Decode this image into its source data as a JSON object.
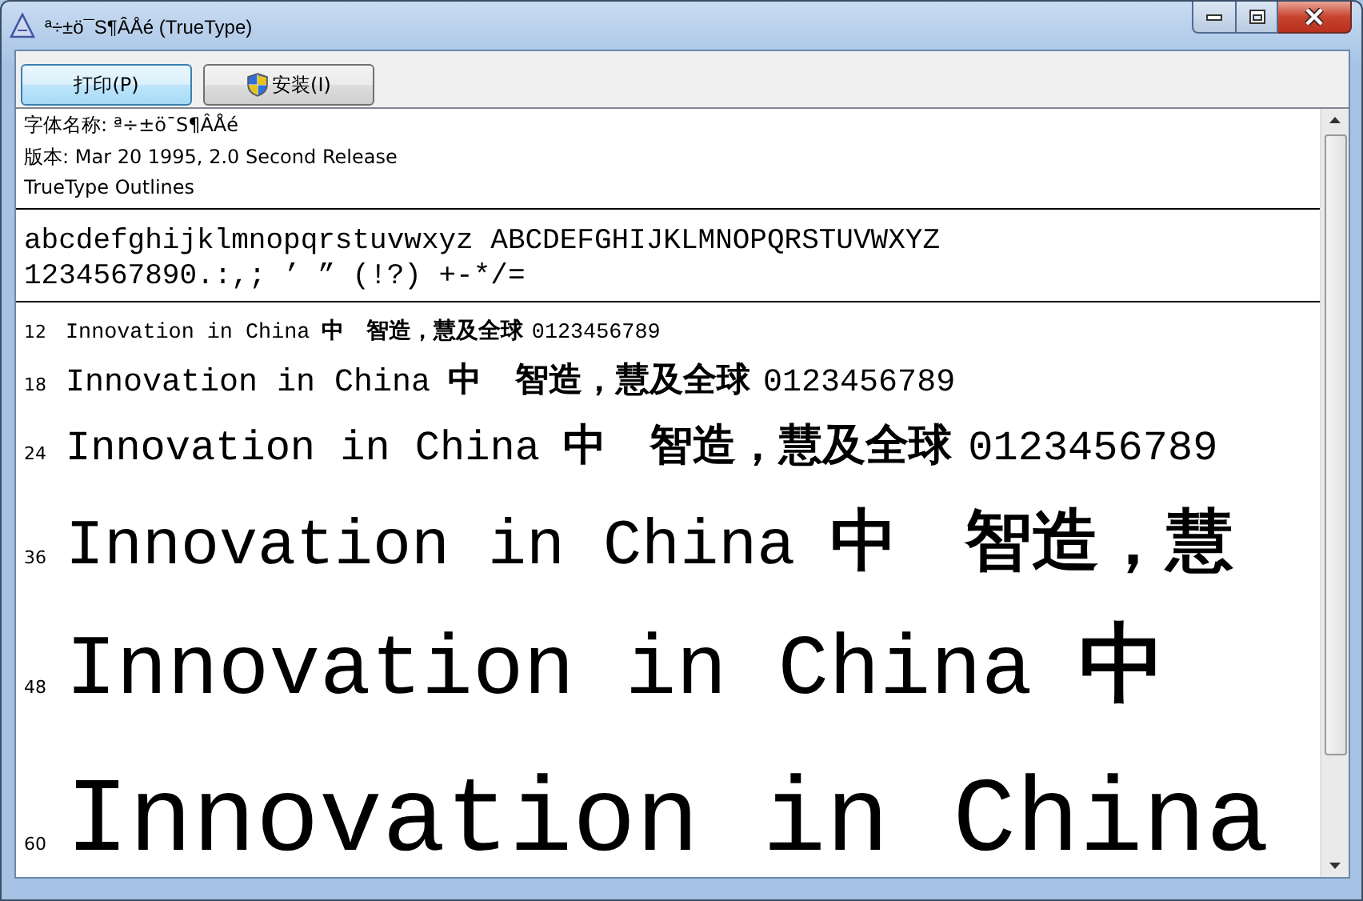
{
  "window": {
    "title": "ª÷±ö¯S¶ÂÅé (TrueType)"
  },
  "toolbar": {
    "buttons": [
      {
        "label": "打印(P)",
        "kind": "plain",
        "focused": true
      },
      {
        "label": "安装(I)",
        "kind": "shield",
        "focused": false
      }
    ]
  },
  "font_info": [
    "字体名称: ª÷±ö¯S¶ÂÅé",
    "版本: Mar 20 1995, 2.0 Second Release",
    "TrueType Outlines"
  ],
  "character_set": [
    "abcdefghijklmnopqrstuvwxyz ABCDEFGHIJKLMNOPQRSTUVWXYZ",
    "1234567890.:,; ’ ” (!?) +-*/="
  ],
  "samples": [
    {
      "size": "12",
      "latin": "Innovation in China",
      "cjk": "中　智造，慧及全球",
      "digits": "0123456789"
    },
    {
      "size": "18",
      "latin": "Innovation in China",
      "cjk": "中　智造，慧及全球",
      "digits": "0123456789"
    },
    {
      "size": "24",
      "latin": "Innovation in China",
      "cjk": "中　智造，慧及全球",
      "digits": "0123456789"
    },
    {
      "size": "36",
      "latin": "Innovation in China",
      "cjk": "中　智造，慧"
    },
    {
      "size": "48",
      "latin": "Innovation in China",
      "cjk": "中"
    },
    {
      "size": "60",
      "latin": "Innovation in China"
    }
  ]
}
